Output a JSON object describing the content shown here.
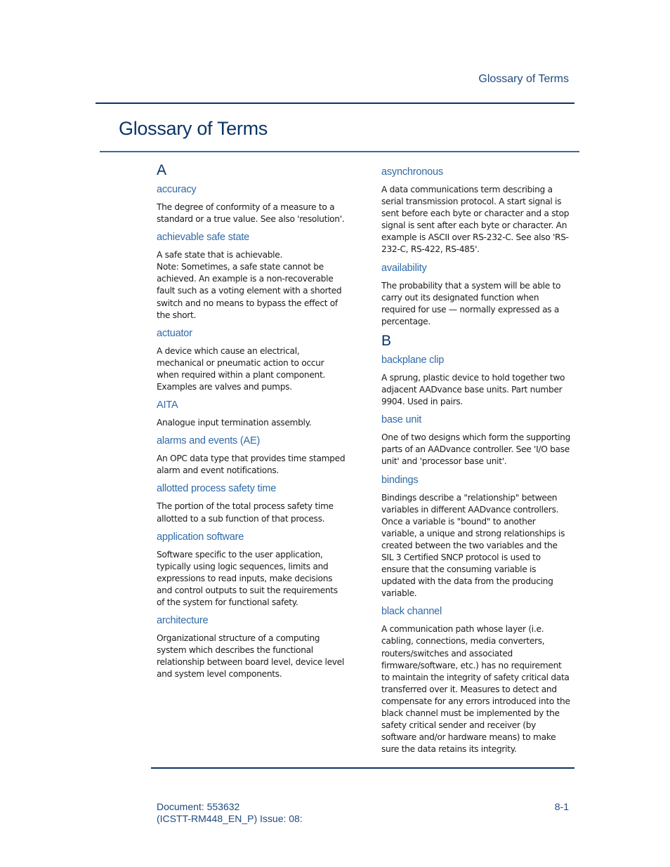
{
  "header": {
    "running_title": "Glossary of Terms"
  },
  "page_title": "Glossary of Terms",
  "columns": [
    {
      "sections": [
        {
          "letter": "A",
          "entries": [
            {
              "term": "accuracy",
              "definition": "The degree of conformity of a measure to a standard or a true value. See also 'resolution'."
            },
            {
              "term": "achievable safe state",
              "definition": "A safe state that is achievable.\nNote: Sometimes, a safe state cannot be achieved. An example is a non-recoverable fault such as a voting element with a shorted switch and no means to bypass the effect of the short."
            },
            {
              "term": "actuator",
              "definition": "A device which cause an electrical, mechanical or pneumatic action to occur when required within a plant component. Examples are valves and pumps."
            },
            {
              "term": "AITA",
              "definition": "Analogue input termination assembly."
            },
            {
              "term": "alarms and events (AE)",
              "definition": "An OPC data type that provides time stamped alarm and event notifications."
            },
            {
              "term": "allotted process safety time",
              "definition": "The portion of the total process safety time allotted to a sub function of that process."
            },
            {
              "term": "application software",
              "definition": "Software specific to the user application, typically using logic sequences, limits and expressions to read inputs, make decisions and control outputs to suit the requirements of the system for functional safety."
            },
            {
              "term": "architecture",
              "definition": "Organizational structure of a computing system which describes the functional relationship between board level, device level and system level components."
            }
          ]
        }
      ]
    },
    {
      "sections": [
        {
          "letter": "",
          "entries": [
            {
              "term": "asynchronous",
              "definition": "A data communications term describing a serial transmission protocol. A start signal is sent before each byte or character and a stop signal is sent after each byte or character. An example is ASCII over RS-232-C. See also 'RS-232-C, RS-422, RS-485'."
            },
            {
              "term": "availability",
              "definition": "The probability that a system will be able to carry out its designated function when required for use — normally expressed as a percentage."
            }
          ]
        },
        {
          "letter": "B",
          "entries": [
            {
              "term": "backplane clip",
              "definition": "A sprung, plastic device to hold together two adjacent AADvance base units. Part number 9904. Used in pairs."
            },
            {
              "term": "base unit",
              "definition": "One of two designs which form the supporting parts of an AADvance controller. See 'I/O base unit' and 'processor base unit'."
            },
            {
              "term": "bindings",
              "definition": "Bindings describe a \"relationship\" between variables in different AADvance controllers. Once a variable is \"bound\" to another variable, a unique and strong relationships is created between the two variables and the SIL 3 Certified SNCP protocol is used to ensure that the consuming variable is updated with the data from the producing variable."
            },
            {
              "term": "black channel",
              "definition": "A communication path whose layer (i.e. cabling, connections, media converters, routers/switches and associated firmware/software, etc.) has no requirement to maintain the integrity of safety critical data transferred over it. Measures to detect and compensate for any errors introduced into the black channel must be implemented by the safety critical sender and receiver (by software and/or hardware means) to make sure the data retains its integrity."
            }
          ]
        }
      ]
    }
  ],
  "footer": {
    "document_line": "Document: 553632",
    "issue_line": "(ICSTT-RM448_EN_P) Issue: 08:",
    "page_number": "8-1"
  }
}
